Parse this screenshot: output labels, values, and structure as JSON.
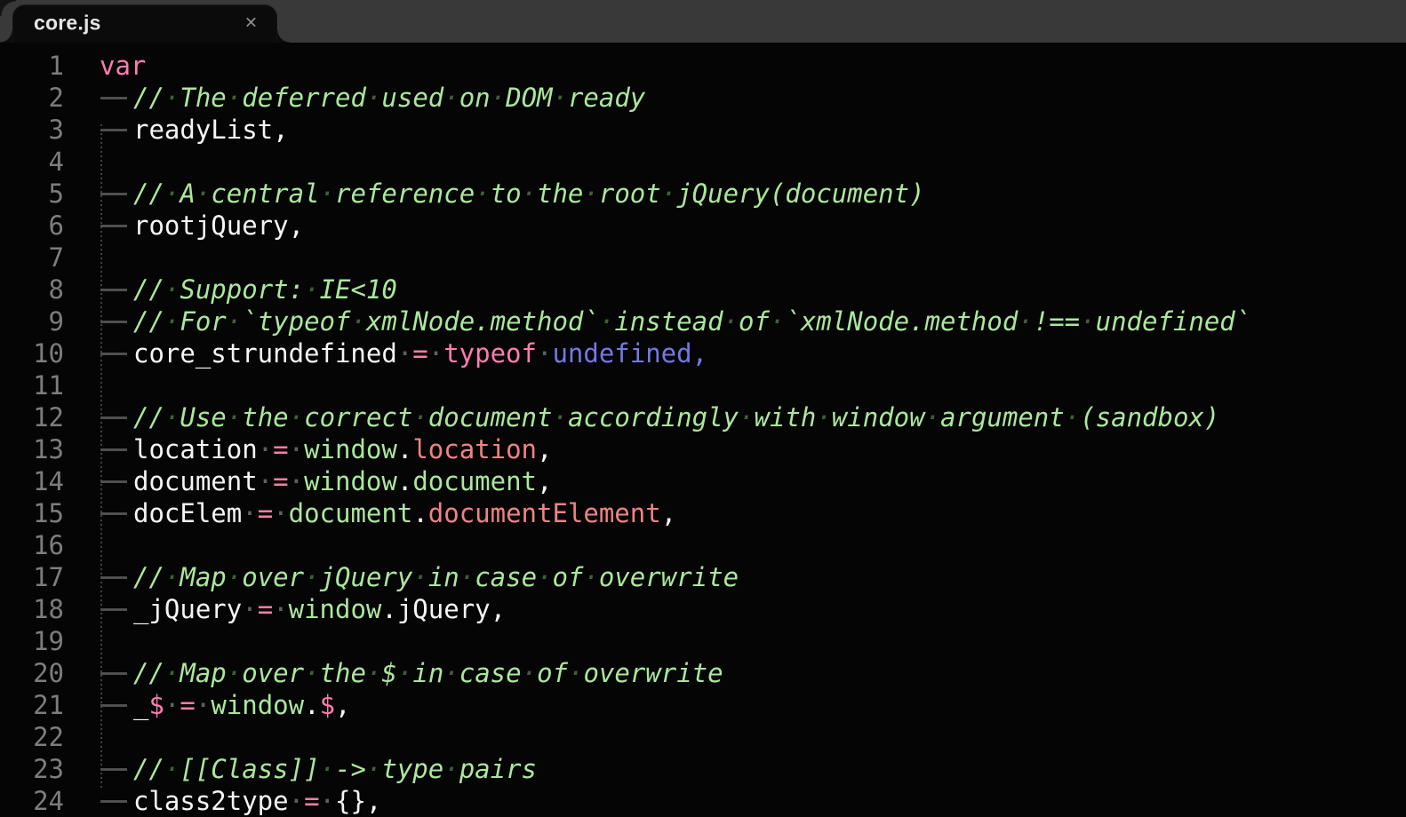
{
  "editor": {
    "tab": {
      "title": "core.js",
      "close_glyph": "✕"
    },
    "colors": {
      "background": "#050505",
      "tabbar_background": "#393939",
      "tab_background": "#0b0b0b",
      "keyword": "#fb7daf",
      "comment": "#abe79c",
      "support": "#abe79c",
      "constant": "#ef8383",
      "language_constant": "#7478e6",
      "plain": "#f5f5f5",
      "line_number": "#7d7d7d",
      "whitespace": "#4f4f4f"
    },
    "lines": [
      {
        "num": 1,
        "indent": 0,
        "tokens": [
          [
            "k",
            "var"
          ]
        ]
      },
      {
        "num": 2,
        "indent": 1,
        "tokens": [
          [
            "c",
            "// The deferred used on DOM ready"
          ]
        ]
      },
      {
        "num": 3,
        "indent": 1,
        "tokens": [
          [
            "p",
            "readyList,"
          ]
        ]
      },
      {
        "num": 4,
        "indent": 0,
        "tokens": []
      },
      {
        "num": 5,
        "indent": 1,
        "tokens": [
          [
            "c",
            "// A central reference to the root jQuery(document)"
          ]
        ]
      },
      {
        "num": 6,
        "indent": 1,
        "tokens": [
          [
            "p",
            "rootjQuery,"
          ]
        ]
      },
      {
        "num": 7,
        "indent": 0,
        "tokens": []
      },
      {
        "num": 8,
        "indent": 1,
        "tokens": [
          [
            "c",
            "// Support: IE<10"
          ]
        ]
      },
      {
        "num": 9,
        "indent": 1,
        "tokens": [
          [
            "c",
            "// For `typeof xmlNode.method` instead of `xmlNode.method !== undefined`"
          ]
        ]
      },
      {
        "num": 10,
        "indent": 1,
        "tokens": [
          [
            "p",
            "core_strundefined "
          ],
          [
            "k",
            "="
          ],
          [
            "p",
            " "
          ],
          [
            "k",
            "typeof"
          ],
          [
            "p",
            " "
          ],
          [
            "u",
            "undefined,"
          ]
        ]
      },
      {
        "num": 11,
        "indent": 0,
        "tokens": []
      },
      {
        "num": 12,
        "indent": 1,
        "tokens": [
          [
            "c",
            "// Use the correct document accordingly with window argument (sandbox)"
          ]
        ]
      },
      {
        "num": 13,
        "indent": 1,
        "tokens": [
          [
            "p",
            "location "
          ],
          [
            "k",
            "="
          ],
          [
            "p",
            " "
          ],
          [
            "s",
            "window"
          ],
          [
            "p",
            "."
          ],
          [
            "n",
            "location"
          ],
          [
            "p",
            ","
          ]
        ]
      },
      {
        "num": 14,
        "indent": 1,
        "tokens": [
          [
            "p",
            "document "
          ],
          [
            "k",
            "="
          ],
          [
            "p",
            " "
          ],
          [
            "s",
            "window"
          ],
          [
            "p",
            "."
          ],
          [
            "s",
            "document"
          ],
          [
            "p",
            ","
          ]
        ]
      },
      {
        "num": 15,
        "indent": 1,
        "tokens": [
          [
            "p",
            "docElem "
          ],
          [
            "k",
            "="
          ],
          [
            "p",
            " "
          ],
          [
            "s",
            "document"
          ],
          [
            "p",
            "."
          ],
          [
            "n",
            "documentElement"
          ],
          [
            "p",
            ","
          ]
        ]
      },
      {
        "num": 16,
        "indent": 0,
        "tokens": []
      },
      {
        "num": 17,
        "indent": 1,
        "tokens": [
          [
            "c",
            "// Map over jQuery in case of overwrite"
          ]
        ]
      },
      {
        "num": 18,
        "indent": 1,
        "tokens": [
          [
            "p",
            "_jQuery "
          ],
          [
            "k",
            "="
          ],
          [
            "p",
            " "
          ],
          [
            "s",
            "window"
          ],
          [
            "p",
            ".jQuery,"
          ]
        ]
      },
      {
        "num": 19,
        "indent": 0,
        "tokens": []
      },
      {
        "num": 20,
        "indent": 1,
        "tokens": [
          [
            "c",
            "// Map over the $ in case of overwrite"
          ]
        ]
      },
      {
        "num": 21,
        "indent": 1,
        "tokens": [
          [
            "p",
            "_"
          ],
          [
            "k",
            "$"
          ],
          [
            "p",
            " "
          ],
          [
            "k",
            "="
          ],
          [
            "p",
            " "
          ],
          [
            "s",
            "window"
          ],
          [
            "p",
            "."
          ],
          [
            "k",
            "$"
          ],
          [
            "p",
            ","
          ]
        ]
      },
      {
        "num": 22,
        "indent": 0,
        "tokens": []
      },
      {
        "num": 23,
        "indent": 1,
        "tokens": [
          [
            "c",
            "// [[Class]] -> type pairs"
          ]
        ]
      },
      {
        "num": 24,
        "indent": 1,
        "tokens": [
          [
            "p",
            "class2type "
          ],
          [
            "k",
            "="
          ],
          [
            "p",
            " "
          ],
          [
            "p",
            "{},"
          ]
        ]
      }
    ]
  }
}
